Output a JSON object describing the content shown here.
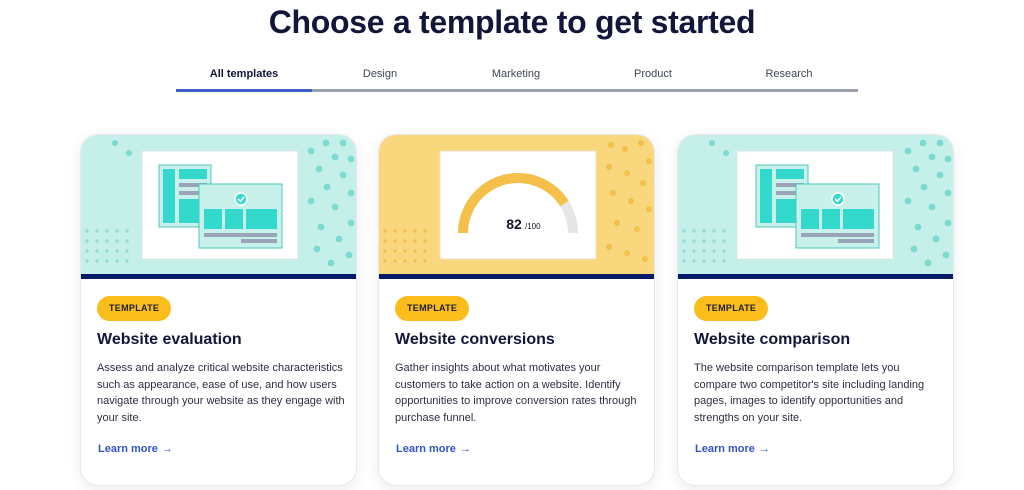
{
  "page": {
    "title": "Choose a template to get started"
  },
  "tabs": [
    {
      "label": "All templates",
      "active": true
    },
    {
      "label": "Design",
      "active": false
    },
    {
      "label": "Marketing",
      "active": false
    },
    {
      "label": "Product",
      "active": false
    },
    {
      "label": "Research",
      "active": false
    }
  ],
  "colors": {
    "accent_tab": "#3d5fcb",
    "badge": "#fbbd1c",
    "teal_bg": "#c5efe9",
    "yellow_bg": "#f9d77c",
    "navy_stripe": "#071a68",
    "link": "#2f55c8"
  },
  "cards": [
    {
      "badge": "TEMPLATE",
      "title": "Website evaluation",
      "description": "Assess and analyze critical website characteristics such as appearance, ease of use, and how users navigate through your website as they engage with your site.",
      "link": "Learn more",
      "link_icon": "arrow-right-icon",
      "art_icon": "website-windows-check-icon"
    },
    {
      "badge": "TEMPLATE",
      "title": "Website conversions",
      "description": "Gather insights about what motivates your customers to take action on a website. Identify opportunities to improve conversion rates through purchase funnel.",
      "link": "Learn more",
      "link_icon": "arrow-right-icon",
      "art_icon": "score-gauge-icon",
      "gauge": {
        "score": "82",
        "out_of": "/100",
        "fraction": 0.82
      }
    },
    {
      "badge": "TEMPLATE",
      "title": "Website comparison",
      "description": "The website comparison template lets you compare two competitor's site including landing pages, images to identify opportunities and strengths on your site.",
      "link": "Learn more",
      "link_icon": "arrow-right-icon",
      "art_icon": "website-windows-check-icon"
    }
  ]
}
